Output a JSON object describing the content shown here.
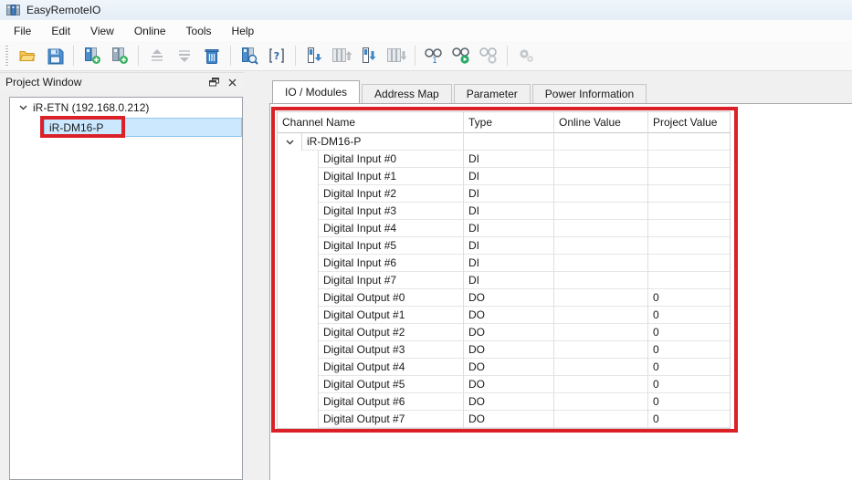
{
  "window": {
    "title": "EasyRemoteIO"
  },
  "menu": {
    "items": [
      {
        "label": "File"
      },
      {
        "label": "Edit"
      },
      {
        "label": "View"
      },
      {
        "label": "Online"
      },
      {
        "label": "Tools"
      },
      {
        "label": "Help"
      }
    ]
  },
  "toolbar": {
    "icons": [
      "open-project-icon",
      "save-project-icon",
      "add-module-icon",
      "insert-module-icon",
      "move-up-icon",
      "move-down-icon",
      "delete-module-icon",
      "scan-module-icon",
      "module-diagnostic-icon",
      "upload-module-icon",
      "upload-all-icon",
      "download-module-icon",
      "download-all-icon",
      "connect-one-icon",
      "monitor-start-icon",
      "monitor-stop-icon",
      "settings-icon"
    ]
  },
  "project_window": {
    "title": "Project Window",
    "tree": [
      {
        "label": "iR-ETN (192.168.0.212)",
        "level": 0,
        "expanded": true
      },
      {
        "label": "iR-DM16-P",
        "level": 1,
        "selected": true
      }
    ]
  },
  "tabs": [
    {
      "label": "IO / Modules",
      "active": true
    },
    {
      "label": "Address Map",
      "active": false
    },
    {
      "label": "Parameter",
      "active": false
    },
    {
      "label": "Power Information",
      "active": false
    }
  ],
  "io_table": {
    "columns": [
      "Channel Name",
      "Type",
      "Online Value",
      "Project Value"
    ],
    "rows": [
      {
        "name": "iR-DM16-P",
        "type": "",
        "online": "",
        "project": "",
        "level": 0,
        "expander": true
      },
      {
        "name": "Digital Input #0",
        "type": "DI",
        "online": "",
        "project": "",
        "level": 1,
        "expander": false
      },
      {
        "name": "Digital Input #1",
        "type": "DI",
        "online": "",
        "project": "",
        "level": 1,
        "expander": false
      },
      {
        "name": "Digital Input #2",
        "type": "DI",
        "online": "",
        "project": "",
        "level": 1,
        "expander": false
      },
      {
        "name": "Digital Input #3",
        "type": "DI",
        "online": "",
        "project": "",
        "level": 1,
        "expander": false
      },
      {
        "name": "Digital Input #4",
        "type": "DI",
        "online": "",
        "project": "",
        "level": 1,
        "expander": false
      },
      {
        "name": "Digital Input #5",
        "type": "DI",
        "online": "",
        "project": "",
        "level": 1,
        "expander": false
      },
      {
        "name": "Digital Input #6",
        "type": "DI",
        "online": "",
        "project": "",
        "level": 1,
        "expander": false
      },
      {
        "name": "Digital Input #7",
        "type": "DI",
        "online": "",
        "project": "",
        "level": 1,
        "expander": false
      },
      {
        "name": "Digital Output #0",
        "type": "DO",
        "online": "",
        "project": "0",
        "level": 1,
        "expander": false
      },
      {
        "name": "Digital Output #1",
        "type": "DO",
        "online": "",
        "project": "0",
        "level": 1,
        "expander": false
      },
      {
        "name": "Digital Output #2",
        "type": "DO",
        "online": "",
        "project": "0",
        "level": 1,
        "expander": false
      },
      {
        "name": "Digital Output #3",
        "type": "DO",
        "online": "",
        "project": "0",
        "level": 1,
        "expander": false
      },
      {
        "name": "Digital Output #4",
        "type": "DO",
        "online": "",
        "project": "0",
        "level": 1,
        "expander": false
      },
      {
        "name": "Digital Output #5",
        "type": "DO",
        "online": "",
        "project": "0",
        "level": 1,
        "expander": false
      },
      {
        "name": "Digital Output #6",
        "type": "DO",
        "online": "",
        "project": "0",
        "level": 1,
        "expander": false
      },
      {
        "name": "Digital Output #7",
        "type": "DO",
        "online": "",
        "project": "0",
        "level": 1,
        "expander": false
      }
    ]
  },
  "colors": {
    "annotation_red": "#dc2027",
    "selection_blue": "#cce8ff",
    "accent_blue": "#2e7cc4",
    "enabled_green": "#2aa968",
    "disabled_gray": "#b9bdc1"
  }
}
